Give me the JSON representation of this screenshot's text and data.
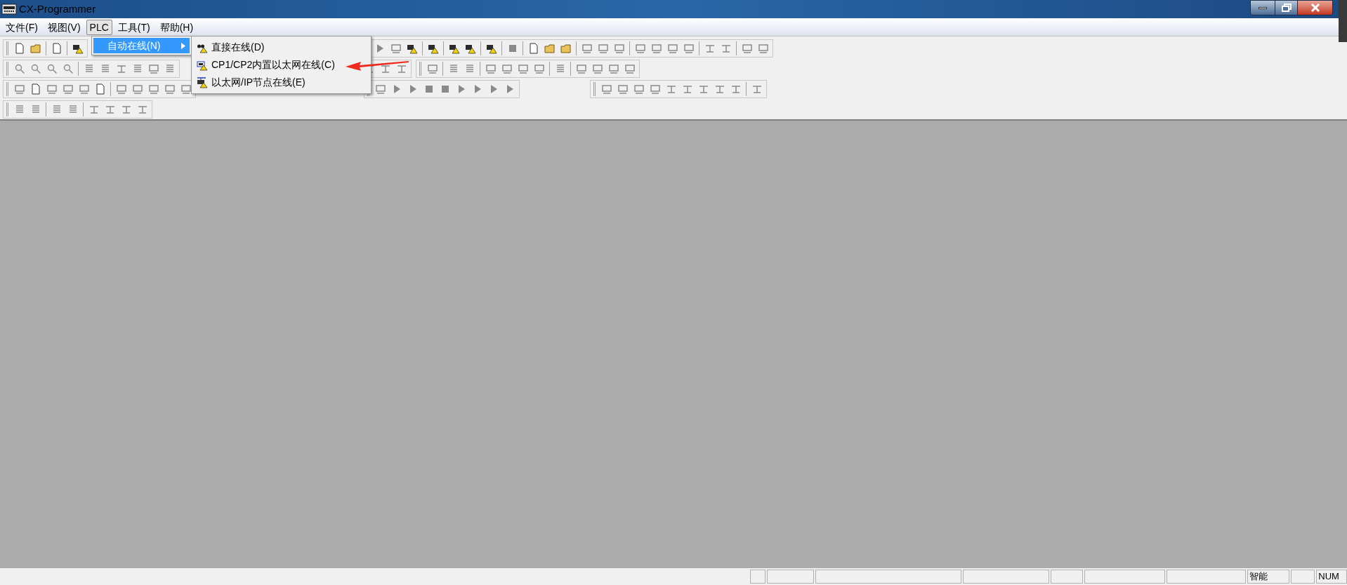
{
  "window": {
    "title": "CX-Programmer"
  },
  "menu_bar": [
    {
      "label": "文件(F)",
      "selected": false
    },
    {
      "label": "视图(V)",
      "selected": false
    },
    {
      "label": "PLC",
      "selected": true
    },
    {
      "label": "工具(T)",
      "selected": false
    },
    {
      "label": "帮助(H)",
      "selected": false
    }
  ],
  "dropdown": [
    {
      "label": "自动在线(N)",
      "selected": true
    }
  ],
  "submenu": [
    {
      "label": "直接在线(D)",
      "kind": "binoculars"
    },
    {
      "label": "CP1/CP2内置以太网在线(C)",
      "kind": "port"
    },
    {
      "label": "以太网/IP节点在线(E)",
      "kind": "network"
    }
  ],
  "status_bar": [
    "智能",
    "NUM"
  ]
}
